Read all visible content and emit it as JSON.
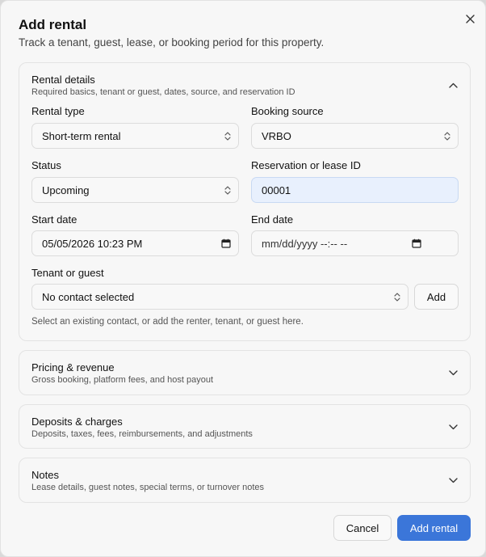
{
  "dialog": {
    "title": "Add rental",
    "subtitle": "Track a tenant, guest, lease, or booking period for this property."
  },
  "sections": {
    "rental_details": {
      "title": "Rental details",
      "description": "Required basics, tenant or guest, dates, source, and reservation ID",
      "expanded": true,
      "fields": {
        "rental_type": {
          "label": "Rental type",
          "value": "Short-term rental"
        },
        "booking_source": {
          "label": "Booking source",
          "value": "VRBO"
        },
        "status": {
          "label": "Status",
          "value": "Upcoming"
        },
        "reservation_id": {
          "label": "Reservation or lease ID",
          "value": "00001"
        },
        "start_date": {
          "label": "Start date",
          "value": "05/05/2026 10:23 PM"
        },
        "end_date": {
          "label": "End date",
          "placeholder": "mm/dd/yyyy --:-- --"
        },
        "tenant": {
          "label": "Tenant or guest",
          "value": "No contact selected",
          "add_label": "Add"
        }
      },
      "hint": "Select an existing contact, or add the renter, tenant, or guest here."
    },
    "pricing": {
      "title": "Pricing & revenue",
      "description": "Gross booking, platform fees, and host payout",
      "expanded": false
    },
    "deposits": {
      "title": "Deposits & charges",
      "description": "Deposits, taxes, fees, reimbursements, and adjustments",
      "expanded": false
    },
    "notes": {
      "title": "Notes",
      "description": "Lease details, guest notes, special terms, or turnover notes",
      "expanded": false
    }
  },
  "footer": {
    "cancel_label": "Cancel",
    "submit_label": "Add rental"
  },
  "colors": {
    "primary": "#3b76d9",
    "filled_field": "#e8f0fd"
  },
  "icons": {
    "close": "close-icon",
    "chevron_up": "chevron-up-icon",
    "chevron_down": "chevron-down-icon",
    "select_arrows": "up-down-arrows-icon",
    "calendar": "calendar-icon"
  }
}
